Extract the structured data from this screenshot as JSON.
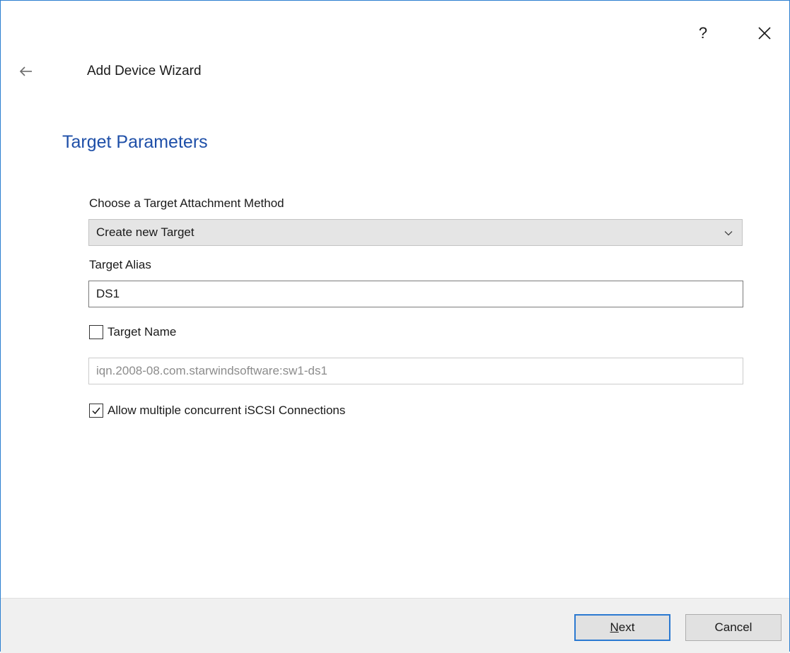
{
  "window": {
    "help_label": "?",
    "wizard_title": "Add Device Wizard"
  },
  "page": {
    "heading": "Target Parameters"
  },
  "form": {
    "attachment_method_label": "Choose a Target Attachment Method",
    "attachment_method_value": "Create new Target",
    "target_alias_label": "Target Alias",
    "target_alias_value": "DS1",
    "target_name_label": "Target Name",
    "target_name_checked": false,
    "target_name_value": "iqn.2008-08.com.starwindsoftware:sw1-ds1",
    "concurrent_label": "Allow multiple concurrent iSCSI Connections",
    "concurrent_checked": true
  },
  "footer": {
    "next_mnemonic": "N",
    "next_rest": "ext",
    "cancel_label": "Cancel"
  },
  "colors": {
    "heading": "#1e4fa8",
    "window_border": "#2b7fd0",
    "default_button_border": "#2b79d1",
    "footer_bg": "#f0f0f0",
    "select_bg": "#e5e5e5"
  },
  "icons": {
    "help": "question-mark-icon",
    "close": "close-icon",
    "back": "back-arrow-icon",
    "dropdown": "chevron-down-icon",
    "check": "checkmark-icon"
  }
}
